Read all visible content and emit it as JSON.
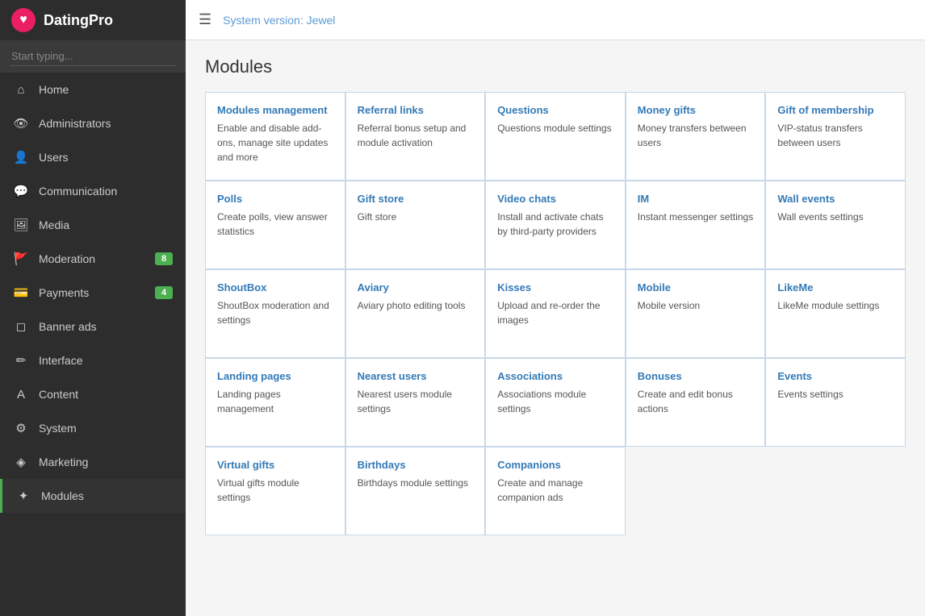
{
  "app": {
    "title": "DatingPro",
    "logo_symbol": "♥",
    "system_version": "System version: Jewel"
  },
  "sidebar": {
    "search_placeholder": "Start typing...",
    "items": [
      {
        "id": "home",
        "label": "Home",
        "icon": "⌂",
        "badge": null
      },
      {
        "id": "administrators",
        "label": "Administrators",
        "icon": "👁",
        "badge": null
      },
      {
        "id": "users",
        "label": "Users",
        "icon": "👤",
        "badge": null
      },
      {
        "id": "communication",
        "label": "Communication",
        "icon": "💬",
        "badge": null
      },
      {
        "id": "media",
        "label": "Media",
        "icon": "🖼",
        "badge": null
      },
      {
        "id": "moderation",
        "label": "Moderation",
        "icon": "🚩",
        "badge": "8"
      },
      {
        "id": "payments",
        "label": "Payments",
        "icon": "💳",
        "badge": "4"
      },
      {
        "id": "banner-ads",
        "label": "Banner ads",
        "icon": "◻",
        "badge": null
      },
      {
        "id": "interface",
        "label": "Interface",
        "icon": "✏",
        "badge": null
      },
      {
        "id": "content",
        "label": "Content",
        "icon": "A",
        "badge": null
      },
      {
        "id": "system",
        "label": "System",
        "icon": "⚙",
        "badge": null
      },
      {
        "id": "marketing",
        "label": "Marketing",
        "icon": "◈",
        "badge": null
      },
      {
        "id": "modules",
        "label": "Modules",
        "icon": "✦",
        "badge": null,
        "active": true
      }
    ]
  },
  "page": {
    "title": "Modules"
  },
  "modules": [
    {
      "id": "modules-management",
      "title": "Modules management",
      "desc": "Enable and disable add-ons, manage site updates and more"
    },
    {
      "id": "referral-links",
      "title": "Referral links",
      "desc": "Referral bonus setup and module activation"
    },
    {
      "id": "questions",
      "title": "Questions",
      "desc": "Questions module settings"
    },
    {
      "id": "money-gifts",
      "title": "Money gifts",
      "desc": "Money transfers between users"
    },
    {
      "id": "gift-of-membership",
      "title": "Gift of membership",
      "desc": "VIP-status transfers between users"
    },
    {
      "id": "polls",
      "title": "Polls",
      "desc": "Create polls, view answer statistics"
    },
    {
      "id": "gift-store",
      "title": "Gift store",
      "desc": "Gift store"
    },
    {
      "id": "video-chats",
      "title": "Video chats",
      "desc": "Install and activate chats by third-party providers"
    },
    {
      "id": "im",
      "title": "IM",
      "desc": "Instant messenger settings"
    },
    {
      "id": "wall-events",
      "title": "Wall events",
      "desc": "Wall events settings"
    },
    {
      "id": "shoutbox",
      "title": "ShoutBox",
      "desc": "ShoutBox moderation and settings"
    },
    {
      "id": "aviary",
      "title": "Aviary",
      "desc": "Aviary photo editing tools"
    },
    {
      "id": "kisses",
      "title": "Kisses",
      "desc": "Upload and re-order the images"
    },
    {
      "id": "mobile",
      "title": "Mobile",
      "desc": "Mobile version"
    },
    {
      "id": "likeme",
      "title": "LikeMe",
      "desc": "LikeMe module settings"
    },
    {
      "id": "landing-pages",
      "title": "Landing pages",
      "desc": "Landing pages management"
    },
    {
      "id": "nearest-users",
      "title": "Nearest users",
      "desc": "Nearest users module settings"
    },
    {
      "id": "associations",
      "title": "Associations",
      "desc": "Associations module settings"
    },
    {
      "id": "bonuses",
      "title": "Bonuses",
      "desc": "Create and edit bonus actions"
    },
    {
      "id": "events",
      "title": "Events",
      "desc": "Events settings"
    },
    {
      "id": "virtual-gifts",
      "title": "Virtual gifts",
      "desc": "Virtual gifts module settings"
    },
    {
      "id": "birthdays",
      "title": "Birthdays",
      "desc": "Birthdays module settings"
    },
    {
      "id": "companions",
      "title": "Companions",
      "desc": "Create and manage companion ads"
    }
  ]
}
